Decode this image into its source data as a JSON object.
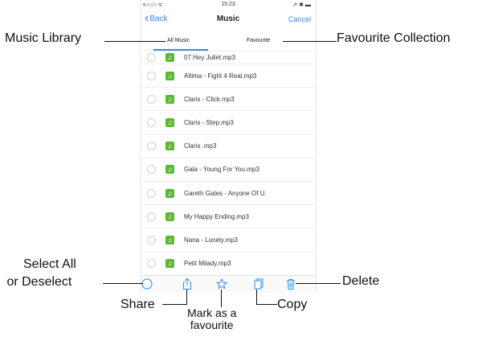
{
  "status": {
    "signal": "•○○○○ ᯤ",
    "time": "15:23",
    "battery": "⇗ ✱ ▬"
  },
  "navbar": {
    "back_label": "Back",
    "back_chevron": "‹",
    "title": "Music",
    "cancel_label": "Cancel"
  },
  "segments": {
    "all_music": "All Music",
    "favourite": "Favourite",
    "selected": "All Music"
  },
  "list": [
    {
      "name": "07 Hey Juliet.mp3"
    },
    {
      "name": "Altima - Fight 4 Real.mp3"
    },
    {
      "name": "Claris - Click.mp3"
    },
    {
      "name": "Claris - Step.mp3"
    },
    {
      "name": "Claris .mp3"
    },
    {
      "name": "Gala - Young For You.mp3"
    },
    {
      "name": "Gareth Gates - Anyone Of U."
    },
    {
      "name": "My Happy Ending.mp3"
    },
    {
      "name": "Nana - Lonely.mp3"
    },
    {
      "name": "Petit Milady.mp3"
    }
  ],
  "icons": {
    "note": "♫"
  },
  "toolbar": {
    "items": [
      "select-all-icon",
      "share-icon",
      "star-icon",
      "copy-icon",
      "trash-icon"
    ]
  },
  "annotations": {
    "music_library": "Music Library",
    "favourite_collection": "Favourite Collection",
    "select_all_line1": "Select All",
    "select_all_line2": "or Deselect",
    "delete": "Delete",
    "share": "Share",
    "copy": "Copy",
    "mark_line1": "Mark as a",
    "mark_line2": "favourite"
  },
  "colors": {
    "accent": "#2d8cf0",
    "note_green": "#5bb833",
    "toolbar_icon": "#2d8cf0"
  }
}
